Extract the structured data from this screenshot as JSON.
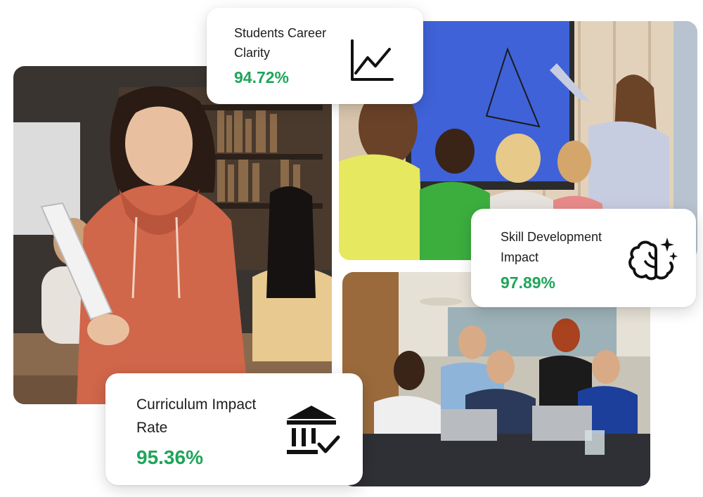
{
  "stats": {
    "career_clarity": {
      "title_line1": "Students Career",
      "title_line2": "Clarity",
      "value": "94.72%",
      "icon": "line-chart-icon"
    },
    "skill_development": {
      "title_line1": "Skill Development",
      "title_line2": "Impact",
      "value": "97.89%",
      "icon": "brain-sparkle-icon"
    },
    "curriculum_impact": {
      "title_line1": "Curriculum Impact",
      "title_line2": "Rate",
      "value": "95.36%",
      "icon": "institution-check-icon"
    }
  },
  "photos": {
    "student_photo": "student-holding-notebook-photo",
    "classroom_photo": "teacher-at-smartboard-photo",
    "office_photo": "business-team-meeting-photo"
  },
  "colors": {
    "accent_green": "#1fa55a",
    "text_dark": "#1d1d1d",
    "card_bg": "#ffffff"
  }
}
